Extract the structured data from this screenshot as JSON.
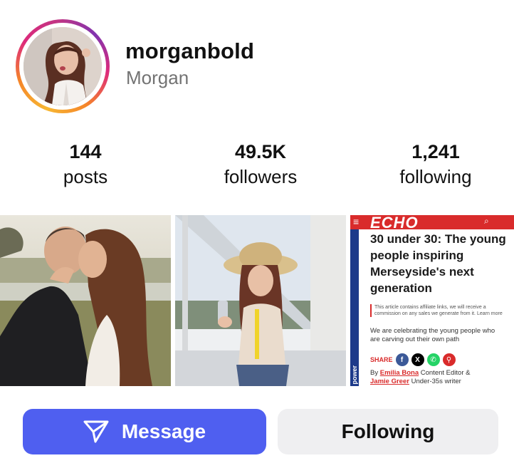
{
  "profile": {
    "username": "morganbold",
    "full_name": "Morgan",
    "avatar_icon": "profile-photo"
  },
  "stats": [
    {
      "value": "144",
      "label": "posts"
    },
    {
      "value": "49.5K",
      "label": "followers"
    },
    {
      "value": "1,241",
      "label": "following"
    }
  ],
  "grid": {
    "article": {
      "brand": "ECHO",
      "title": "30 under 30: The young people inspiring Merseyside's next generation",
      "affiliate_note": "This article contains affiliate links, we will receive a commission on any sales we generate from it. Learn more",
      "lead": "We are celebrating the young people who are carving out their own path",
      "share_label": "SHARE",
      "side_text": "The power",
      "byline_prefix": "By",
      "author_1": "Emilia Bona",
      "author_1_role": "Content Editor &",
      "author_2": "Jamie Greer",
      "author_2_role": "Under-35s writer"
    }
  },
  "actions": {
    "message_label": "Message",
    "following_label": "Following"
  },
  "colors": {
    "message_button": "#4f5ff0",
    "following_button": "#efeff1",
    "echo_red": "#d92b2b"
  }
}
